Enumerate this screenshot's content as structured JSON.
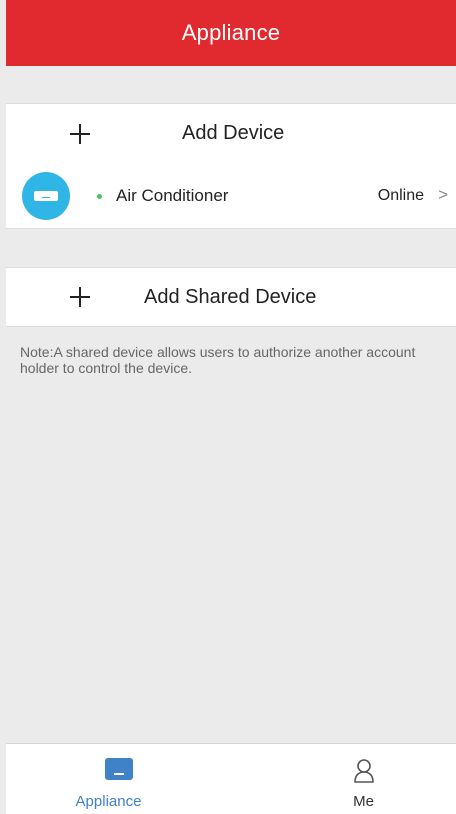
{
  "header": {
    "title": "Appliance"
  },
  "add_device": {
    "label": "Add Device",
    "icon": "plus-icon"
  },
  "devices": [
    {
      "name": "Air Conditioner",
      "status": "Online",
      "icon": "air-conditioner-icon",
      "status_color": "#4cc25d"
    }
  ],
  "add_shared_device": {
    "label": "Add Shared Device",
    "icon": "plus-icon"
  },
  "note": "Note:A shared device allows users to authorize another account holder to control the device.",
  "tabbar": {
    "tabs": [
      {
        "label": "Appliance",
        "icon": "appliance-icon",
        "active": true
      },
      {
        "label": "Me",
        "icon": "person-icon",
        "active": false
      }
    ]
  },
  "colors": {
    "header": "#e02a2f",
    "accent": "#3f82c7",
    "device_icon_bg": "#2fb6e6",
    "background": "#ebebeb"
  }
}
